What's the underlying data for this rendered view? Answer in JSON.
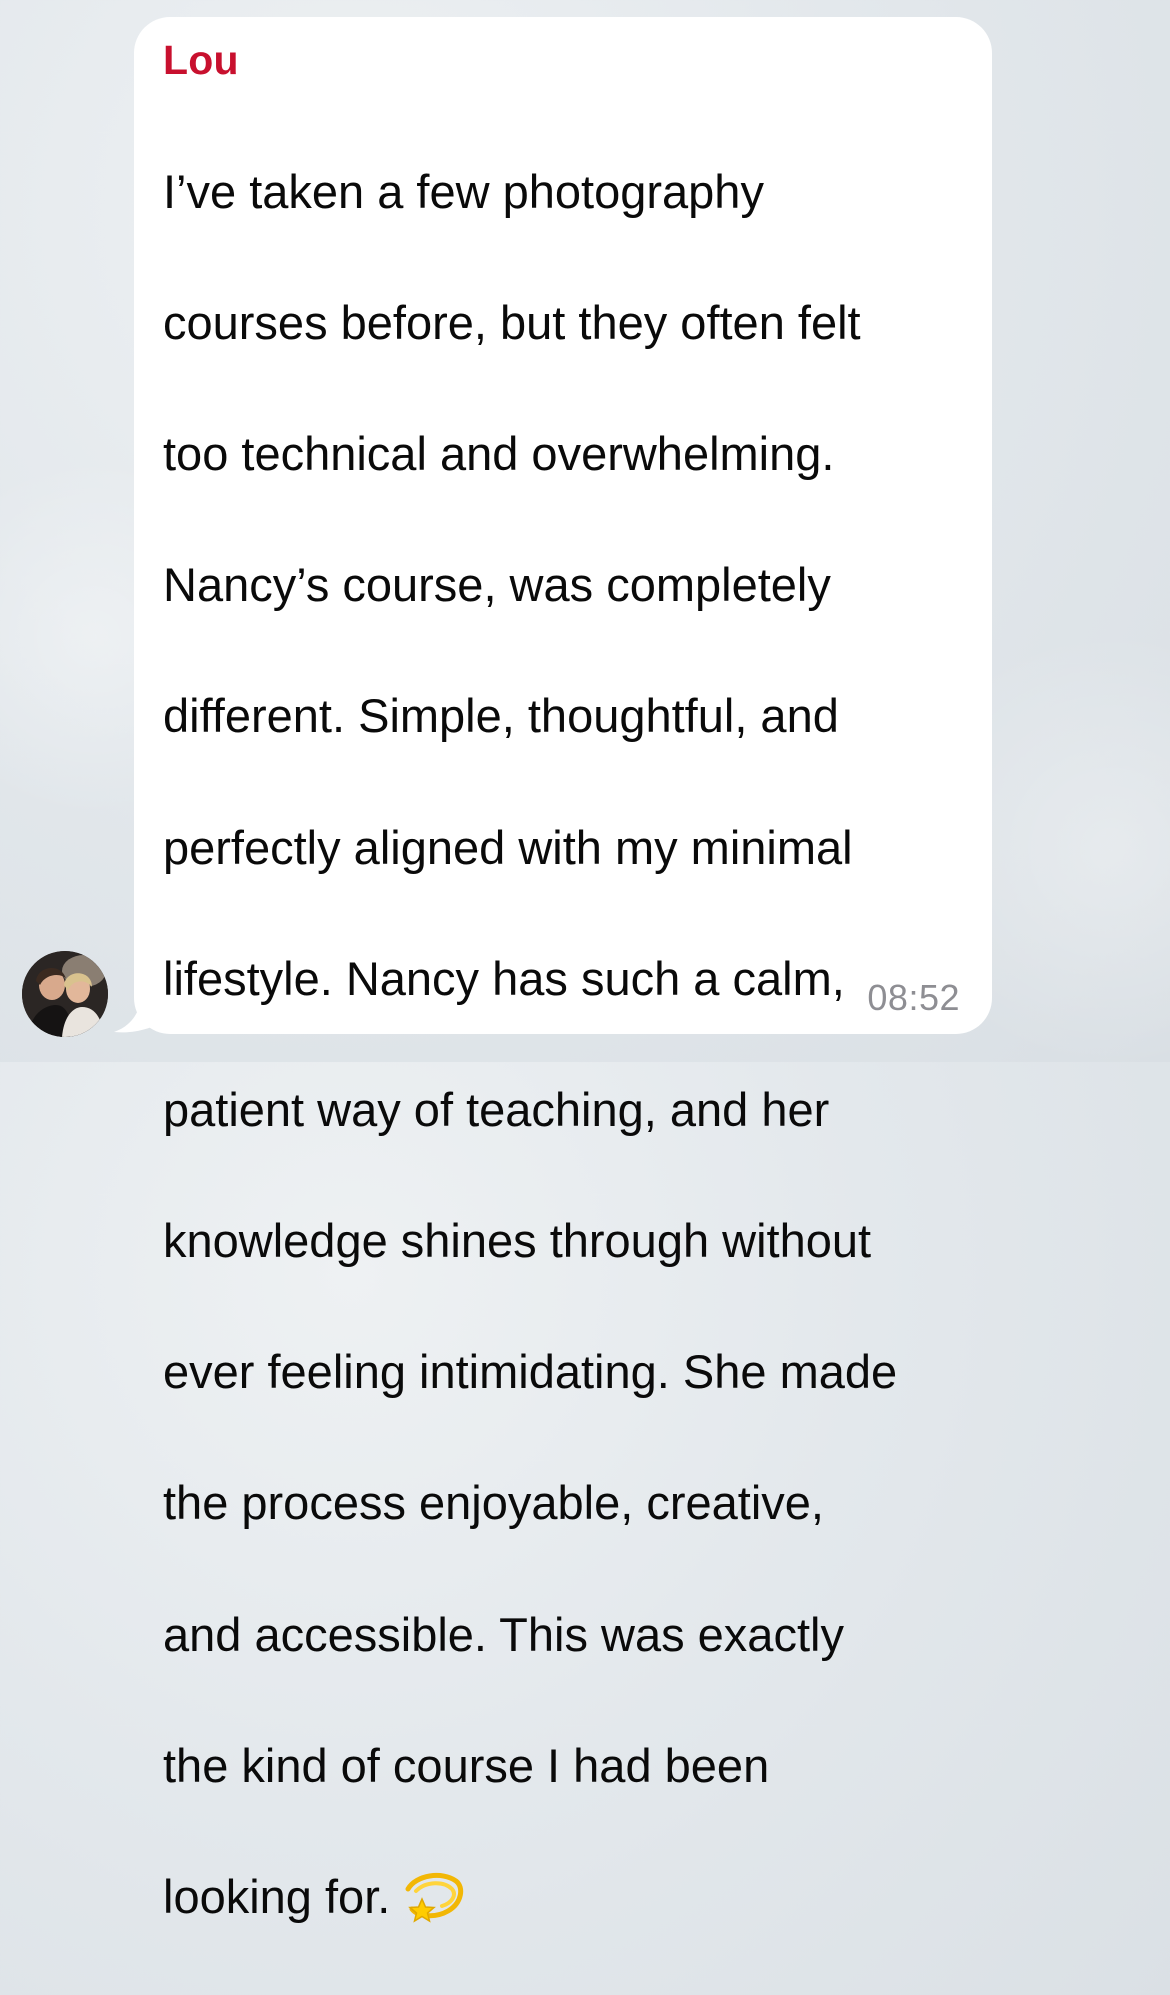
{
  "chat": {
    "message": {
      "sender": "Lou",
      "lines": [
        "I’ve taken a few photography",
        "courses before, but they often felt",
        "too technical and overwhelming.",
        "Nancy’s course, was completely",
        "different. Simple, thoughtful, and",
        "perfectly aligned with my minimal",
        "lifestyle. Nancy has such a calm,",
        "patient way of teaching, and her",
        "knowledge shines through without",
        "ever feeling intimidating. She made",
        "the process enjoyable, creative,",
        "and accessible. This was exactly",
        "the kind of course I had been",
        "looking for."
      ],
      "emoji": "dizzy-star",
      "time": "08:52"
    },
    "avatar": {
      "icon": "profile-photo"
    }
  },
  "colors": {
    "sender": "#c8102e",
    "bubble": "#ffffff",
    "text": "#0a0a0a",
    "timestamp": "#8e8e93"
  }
}
